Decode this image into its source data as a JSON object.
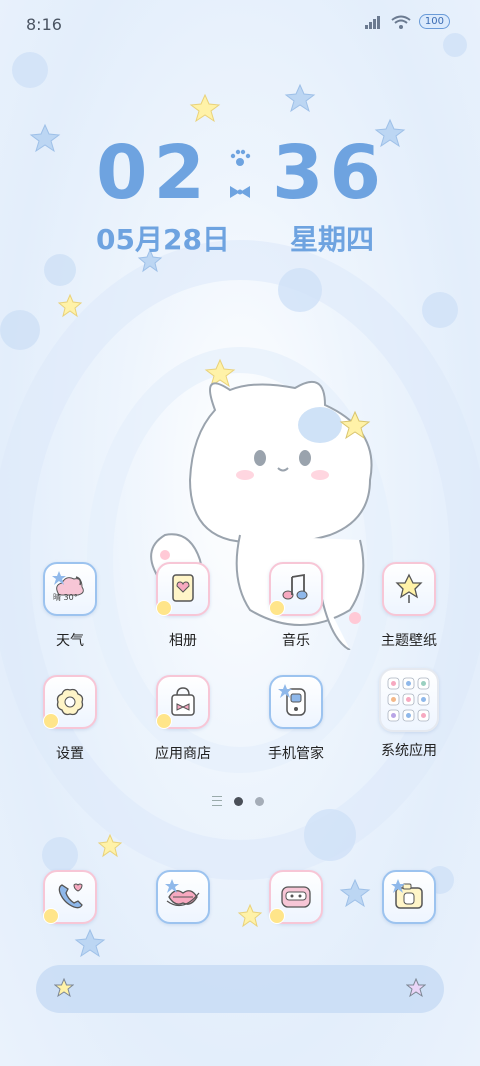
{
  "status": {
    "time": "8:16",
    "battery": "100"
  },
  "clock": {
    "hours": "02",
    "minutes": "36"
  },
  "date": {
    "date": "05月28日",
    "weekday": "星期四"
  },
  "weather_widget": {
    "temp": "晴 30°"
  },
  "apps_row1": [
    {
      "label": "天气",
      "icon": "weather-icon"
    },
    {
      "label": "相册",
      "icon": "gallery-icon"
    },
    {
      "label": "音乐",
      "icon": "music-icon"
    },
    {
      "label": "主题壁纸",
      "icon": "themes-icon"
    }
  ],
  "apps_row2": [
    {
      "label": "设置",
      "icon": "settings-icon"
    },
    {
      "label": "应用商店",
      "icon": "app-store-icon"
    },
    {
      "label": "手机管家",
      "icon": "phone-manager-icon"
    },
    {
      "label": "系统应用",
      "icon": "system-apps-folder-icon"
    }
  ],
  "dock": [
    {
      "icon": "phone-icon"
    },
    {
      "icon": "messages-icon"
    },
    {
      "icon": "browser-icon"
    },
    {
      "icon": "camera-icon"
    }
  ],
  "pager": {
    "pages": 2,
    "active": 1
  }
}
